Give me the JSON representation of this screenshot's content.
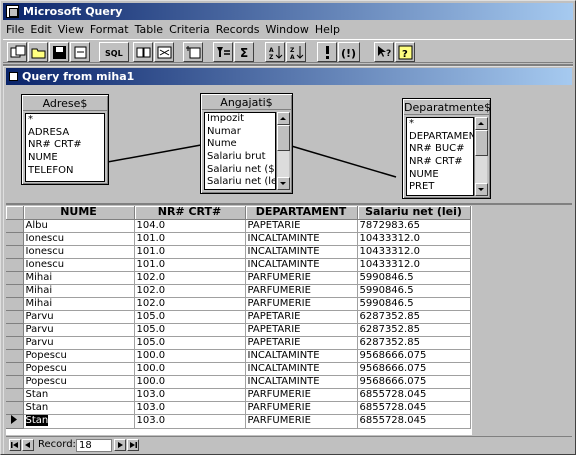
{
  "app": {
    "title": "Microsoft Query",
    "menu": [
      "File",
      "Edit",
      "View",
      "Format",
      "Table",
      "Criteria",
      "Records",
      "Window",
      "Help"
    ],
    "toolbar": [
      "new-query",
      "open",
      "save",
      "sql",
      "show-tables",
      "show-criteria",
      "add-tables",
      "criteria-equals",
      "sum",
      "sort-ascending",
      "sort-descending",
      "query-now",
      "auto-query",
      "context-help",
      "help"
    ]
  },
  "query_window": {
    "title": "Query from miha1",
    "tables": [
      {
        "name": "Adrese$",
        "fields": [
          "*",
          "ADRESA",
          "NR# CRT#",
          "NUME",
          "TELEFON"
        ]
      },
      {
        "name": "Angajati$",
        "fields": [
          "Impozit",
          "Numar",
          "Nume",
          "Salariu brut",
          "Salariu net ($)",
          "Salariu net (lei)"
        ]
      },
      {
        "name": "Deparatmente$",
        "fields": [
          "*",
          "DEPARTAMEN",
          "NR# BUC#",
          "NR# CRT#",
          "NUME",
          "PRET"
        ]
      }
    ],
    "grid": {
      "columns": [
        "NUME",
        "NR# CRT#",
        "DEPARTAMENT",
        "Salariu net (lei)"
      ],
      "rows": [
        [
          "Albu",
          "104.0",
          "PAPETARIE",
          "7872983.65"
        ],
        [
          "Ionescu",
          "101.0",
          "INCALTAMINTE",
          "10433312.0"
        ],
        [
          "Ionescu",
          "101.0",
          "INCALTAMINTE",
          "10433312.0"
        ],
        [
          "Ionescu",
          "101.0",
          "INCALTAMINTE",
          "10433312.0"
        ],
        [
          "Mihai",
          "102.0",
          "PARFUMERIE",
          "5990846.5"
        ],
        [
          "Mihai",
          "102.0",
          "PARFUMERIE",
          "5990846.5"
        ],
        [
          "Mihai",
          "102.0",
          "PARFUMERIE",
          "5990846.5"
        ],
        [
          "Parvu",
          "105.0",
          "PAPETARIE",
          "6287352.85"
        ],
        [
          "Parvu",
          "105.0",
          "PAPETARIE",
          "6287352.85"
        ],
        [
          "Parvu",
          "105.0",
          "PAPETARIE",
          "6287352.85"
        ],
        [
          "Popescu",
          "100.0",
          "INCALTAMINTE",
          "9568666.075"
        ],
        [
          "Popescu",
          "100.0",
          "INCALTAMINTE",
          "9568666.075"
        ],
        [
          "Popescu",
          "100.0",
          "INCALTAMINTE",
          "9568666.075"
        ],
        [
          "Stan",
          "103.0",
          "PARFUMERIE",
          "6855728.045"
        ],
        [
          "Stan",
          "103.0",
          "PARFUMERIE",
          "6855728.045"
        ],
        [
          "Stan",
          "103.0",
          "PARFUMERIE",
          "6855728.045"
        ]
      ],
      "current_row": 15
    },
    "record_bar": {
      "label": "Record:",
      "value": "18"
    }
  }
}
